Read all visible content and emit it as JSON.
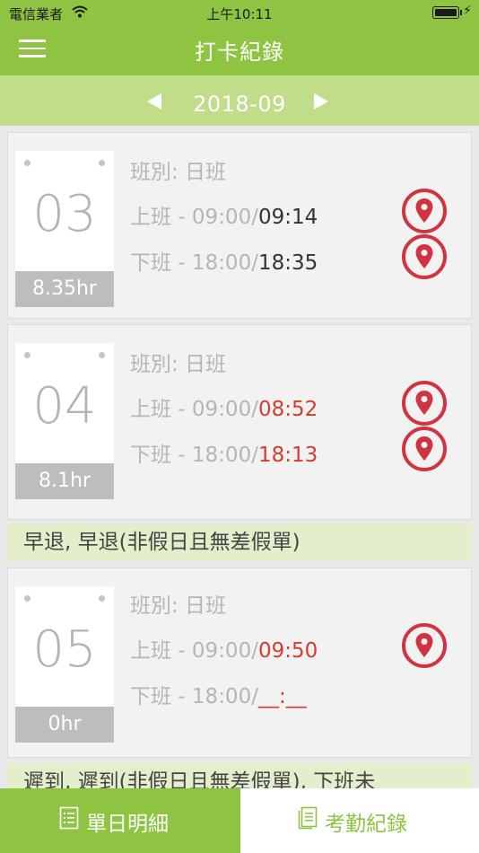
{
  "status": {
    "carrier": "電信業者",
    "time": "上午10:11"
  },
  "nav": {
    "title": "打卡紀錄"
  },
  "month": {
    "label": "2018-09"
  },
  "records": [
    {
      "day": "03",
      "hours": "8.35hr",
      "shift": "班別: 日班",
      "in_label": "上班 - 09:00/",
      "in_actual": "09:14",
      "out_label": "下班 - 18:00/",
      "out_actual": "18:35"
    },
    {
      "day": "04",
      "hours": "8.1hr",
      "shift": "班別: 日班",
      "in_label": "上班 - 09:00/",
      "in_actual": "08:52",
      "out_label": "下班 - 18:00/",
      "out_actual": "18:13",
      "note": "早退, 早退(非假日且無差假單)"
    },
    {
      "day": "05",
      "hours": "0hr",
      "shift": "班別: 日班",
      "in_label": "上班 - 09:00/",
      "in_actual": "09:50",
      "out_label": "下班 - 18:00/",
      "out_actual": "__:__",
      "note": "遲到, 遲到(非假日且無差假單), 下班未"
    }
  ],
  "tabs": {
    "daily": "單日明細",
    "attendance": "考勤紀錄"
  },
  "colors": {
    "brand_green": "#8fc342",
    "light_green": "#c1dd8a",
    "note_bg": "#e3efcb",
    "alert_red": "#d93a2f",
    "pin_red": "#cf3440"
  },
  "icons": {
    "menu": "hamburger-icon",
    "pin": "location-pin-icon",
    "list": "list-icon",
    "document": "document-icon"
  }
}
